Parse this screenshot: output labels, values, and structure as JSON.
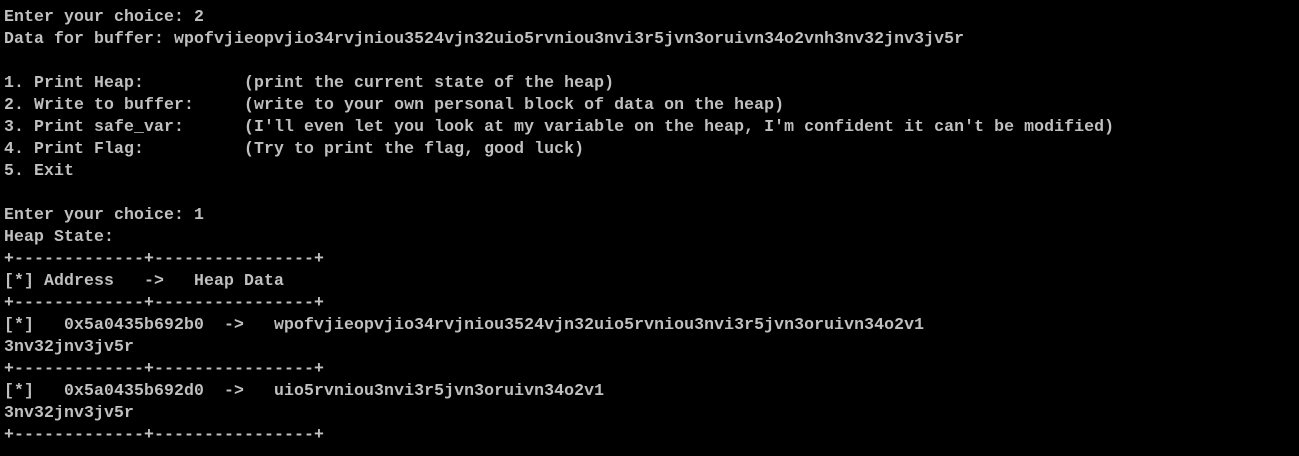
{
  "terminal": {
    "text_color": "#c0c0c0",
    "background_color": "#000000",
    "lines": [
      "Enter your choice: 2",
      "Data for buffer: wpofvjieopvjio34rvjniou3524vjn32uio5rvniou3nvi3r5jvn3oruivn34o2vnh3nv32jnv3jv5r",
      "",
      "1. Print Heap:          (print the current state of the heap)",
      "2. Write to buffer:     (write to your own personal block of data on the heap)",
      "3. Print safe_var:      (I'll even let you look at my variable on the heap, I'm confident it can't be modified)",
      "4. Print Flag:          (Try to print the flag, good luck)",
      "5. Exit",
      "",
      "Enter your choice: 1",
      "Heap State:",
      "+-------------+----------------+",
      "[*] Address   ->   Heap Data",
      "+-------------+----------------+",
      "[*]   0x5a0435b692b0  ->   wpofvjieopvjio34rvjniou3524vjn32uio5rvniou3nvi3r5jvn3oruivn34o2v1",
      "3nv32jnv3jv5r",
      "+-------------+----------------+",
      "[*]   0x5a0435b692d0  ->   uio5rvniou3nvi3r5jvn3oruivn34o2v1",
      "3nv32jnv3jv5r",
      "+-------------+----------------+"
    ]
  }
}
